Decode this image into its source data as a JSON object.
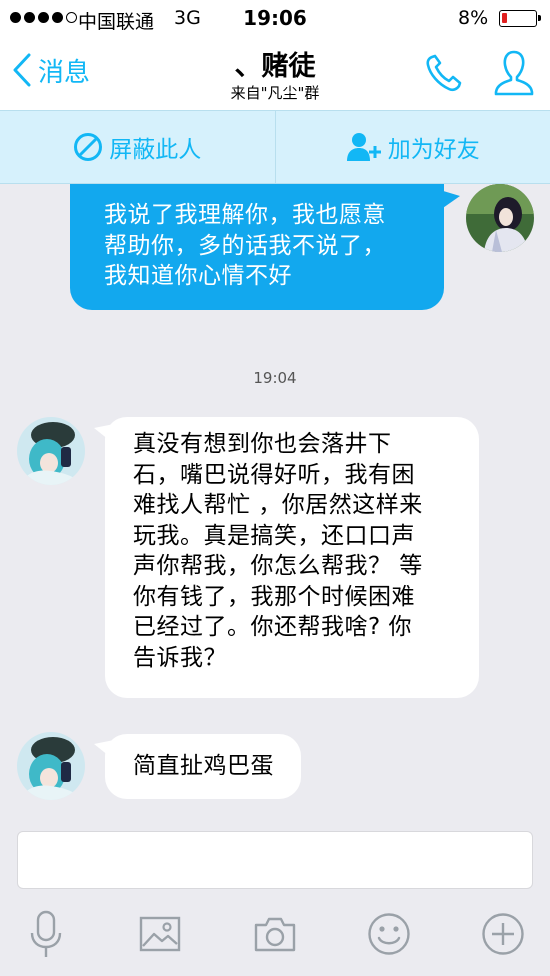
{
  "status_bar": {
    "carrier": "中国联通",
    "network": "3G",
    "time": "19:06",
    "battery": "8%",
    "battery_level": 0.08
  },
  "nav": {
    "back_label": "消息",
    "title": "、赌徒",
    "subtitle": "来自\"凡尘\"群"
  },
  "actions": {
    "block_label": "屏蔽此人",
    "add_friend_label": "加为好友"
  },
  "messages": [
    {
      "direction": "sent",
      "lines": [
        "我说了我理解你，我也愿意",
        "帮助你，多的话我不说了，",
        "我知道你心情不好"
      ]
    },
    {
      "direction": "received",
      "lines": [
        "真没有想到你也会落井下",
        "石，嘴巴说得好听，我有困",
        "难找人帮忙 ，你居然这样来",
        "玩我。真是搞笑，还口口声",
        "声你帮我，你怎么帮我？ 等",
        "你有钱了，我那个时候困难",
        "已经过了。你还帮我啥? 你",
        "告诉我？"
      ]
    },
    {
      "direction": "received",
      "lines": [
        "简直扯鸡巴蛋"
      ]
    }
  ],
  "timestamp": "19:04",
  "input": {
    "value": ""
  },
  "toolbar": {
    "icons": [
      "microphone-icon",
      "image-icon",
      "camera-icon",
      "emoji-icon",
      "plus-icon"
    ]
  },
  "colors": {
    "accent": "#12b7f5",
    "sent_bubble": "#12a8ee",
    "action_bar_bg": "#d6f1fc",
    "background": "#ebebf0"
  }
}
